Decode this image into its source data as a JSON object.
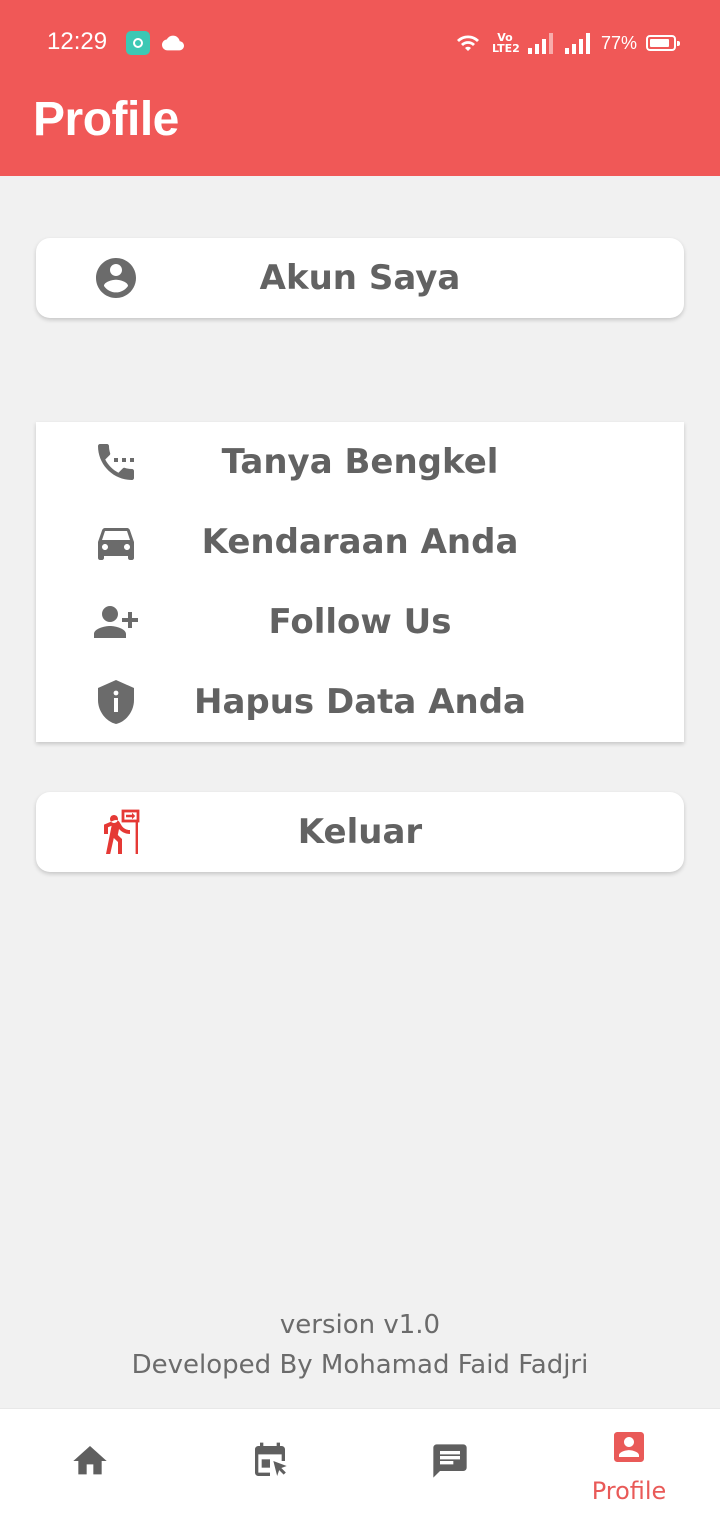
{
  "colors": {
    "primary": "#f05857",
    "icon_gray": "#6b6b6b",
    "logout_red": "#e53935",
    "background": "#f1f1f1"
  },
  "status_bar": {
    "time": "12:29",
    "volte": "Vo LTE2",
    "battery": "77%",
    "icons": [
      "app-notification-icon",
      "cloud-icon",
      "wifi-icon",
      "signal-icon",
      "signal-icon",
      "battery-icon"
    ]
  },
  "header": {
    "title": "Profile"
  },
  "account": {
    "label": "Akun Saya",
    "icon": "account-circle-icon"
  },
  "menu": {
    "items": [
      {
        "label": "Tanya Bengkel",
        "icon": "phone-icon"
      },
      {
        "label": "Kendaraan Anda",
        "icon": "car-icon"
      },
      {
        "label": "Follow Us",
        "icon": "person-add-icon"
      },
      {
        "label": "Hapus Data Anda",
        "icon": "shield-info-icon"
      }
    ]
  },
  "logout": {
    "label": "Keluar",
    "icon": "exit-icon"
  },
  "footer": {
    "version": "version v1.0",
    "developer": "Developed By Mohamad Faid Fadjri"
  },
  "bottom_nav": {
    "items": [
      {
        "icon": "home-icon",
        "label": ""
      },
      {
        "icon": "calendar-icon",
        "label": ""
      },
      {
        "icon": "chat-icon",
        "label": ""
      },
      {
        "icon": "profile-icon",
        "label": "Profile",
        "active": true
      }
    ]
  }
}
